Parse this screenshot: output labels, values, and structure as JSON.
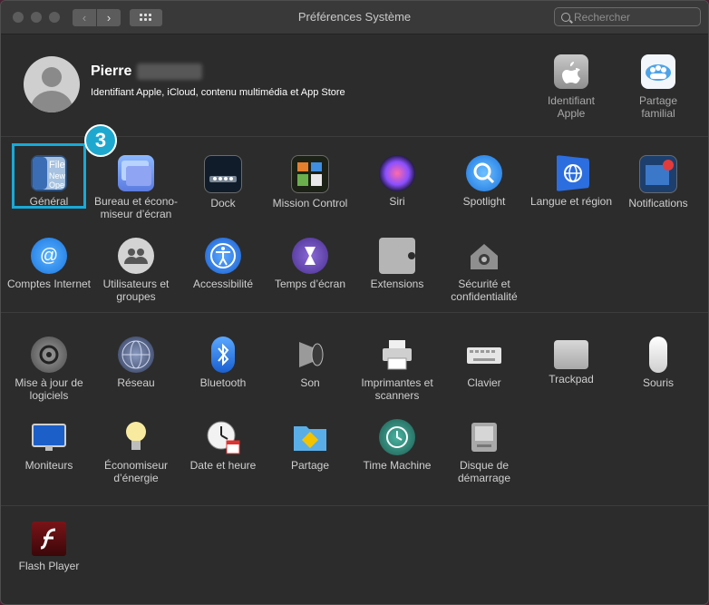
{
  "window": {
    "title": "Préférences Système"
  },
  "toolbar": {
    "back": "‹",
    "forward": "›",
    "search_placeholder": "Rechercher"
  },
  "user": {
    "name": "Pierre",
    "subtitle": "Identifiant Apple, iCloud, contenu multimédia et App Store"
  },
  "top_items": [
    {
      "label": "Identifiant Apple",
      "icon": "apple-id-icon"
    },
    {
      "label": "Partage familial",
      "icon": "family-sharing-icon"
    }
  ],
  "step_badge": "3",
  "row1": [
    {
      "label": "Général",
      "icon": "general-icon",
      "color": "#4a7bbd"
    },
    {
      "label": "Bureau et écono-miseur d’écran",
      "icon": "desktop-icon",
      "color": "#5b8df0"
    },
    {
      "label": "Dock",
      "icon": "dock-icon",
      "color": "#1f2a36"
    },
    {
      "label": "Mission Control",
      "icon": "mission-control-icon",
      "color": "#2d3a28"
    },
    {
      "label": "Siri",
      "icon": "siri-icon",
      "color": "#3a2a6a"
    },
    {
      "label": "Spotlight",
      "icon": "spotlight-icon",
      "color": "#2b8ef0"
    },
    {
      "label": "Langue et région",
      "icon": "language-icon",
      "color": "#2d6ad6"
    },
    {
      "label": "Notifications",
      "icon": "notifications-icon",
      "color": "#2f5d9a"
    }
  ],
  "row2": [
    {
      "label": "Comptes Internet",
      "icon": "internet-accounts-icon",
      "color": "#2a8ae0"
    },
    {
      "label": "Utilisateurs et groupes",
      "icon": "users-icon",
      "color": "#cfcfcf"
    },
    {
      "label": "Accessibilité",
      "icon": "accessibility-icon",
      "color": "#2e7de0"
    },
    {
      "label": "Temps d’écran",
      "icon": "screen-time-icon",
      "color": "#5a3fa0"
    },
    {
      "label": "Extensions",
      "icon": "extensions-icon",
      "color": "#a9a9a9"
    },
    {
      "label": "Sécurité et confidentialité",
      "icon": "security-icon",
      "color": "#9a9a9a"
    }
  ],
  "row3": [
    {
      "label": "Mise à jour de logiciels",
      "icon": "software-update-icon",
      "color": "#7a7a7a"
    },
    {
      "label": "Réseau",
      "icon": "network-icon",
      "color": "#4a5a7a"
    },
    {
      "label": "Bluetooth",
      "icon": "bluetooth-icon",
      "color": "#2e8ee0"
    },
    {
      "label": "Son",
      "icon": "sound-icon",
      "color": "#7a7a7a"
    },
    {
      "label": "Imprimantes et scanners",
      "icon": "printer-icon",
      "color": "#9a9a9a"
    },
    {
      "label": "Clavier",
      "icon": "keyboard-icon",
      "color": "#d7d7d7"
    },
    {
      "label": "Trackpad",
      "icon": "trackpad-icon",
      "color": "#bdbdbd"
    },
    {
      "label": "Souris",
      "icon": "mouse-icon",
      "color": "#e8e8e8"
    }
  ],
  "row4": [
    {
      "label": "Moniteurs",
      "icon": "displays-icon",
      "color": "#2e7de0"
    },
    {
      "label": "Économiseur d’énergie",
      "icon": "energy-saver-icon",
      "color": "#f3e9a0"
    },
    {
      "label": "Date et heure",
      "icon": "date-time-icon",
      "color": "#e9e9e9"
    },
    {
      "label": "Partage",
      "icon": "sharing-icon",
      "color": "#4aa0d8"
    },
    {
      "label": "Time Machine",
      "icon": "time-machine-icon",
      "color": "#2a8a7a"
    },
    {
      "label": "Disque de démarrage",
      "icon": "startup-disk-icon",
      "color": "#9a9a9a"
    }
  ],
  "row5": [
    {
      "label": "Flash Player",
      "icon": "flash-player-icon",
      "color": "#5a0f12"
    }
  ]
}
